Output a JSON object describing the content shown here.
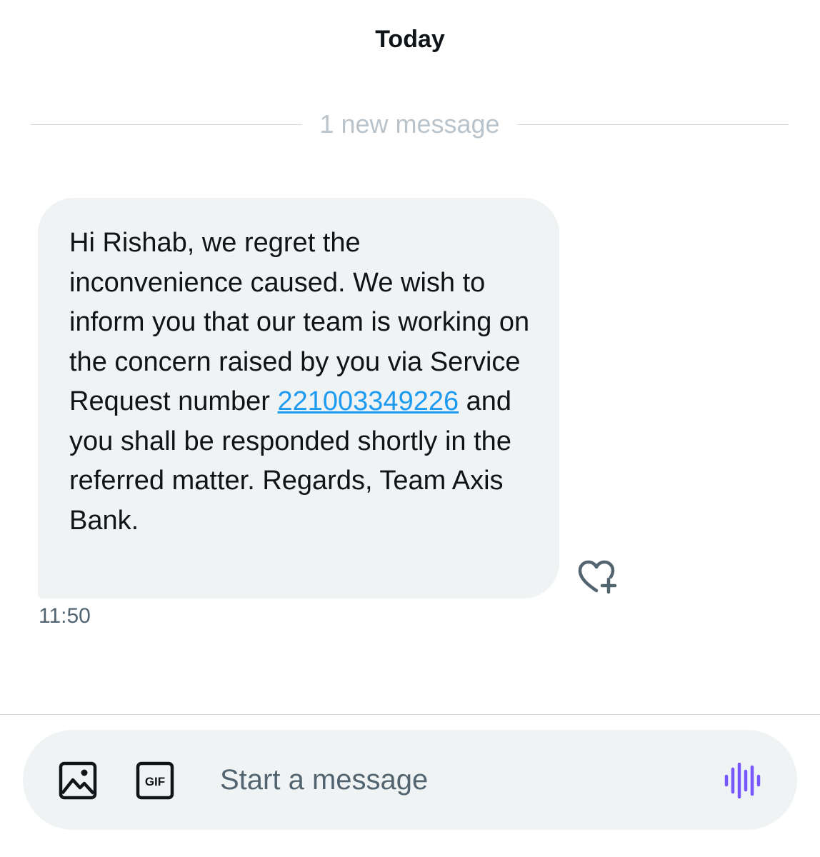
{
  "conversation": {
    "day_label": "Today",
    "new_messages_label": "1 new message"
  },
  "message": {
    "text_before_link": "Hi Rishab, we regret the inconvenience caused. We wish to inform you that our team is working on the concern raised by you via Service Request number ",
    "service_request_number": "221003349226",
    "text_after_link": " and you shall be responded shortly in the referred matter. Regards, Team Axis Bank.",
    "time": "11:50",
    "react_icon": "heart-plus-icon"
  },
  "composer": {
    "placeholder": "Start a message",
    "media_icon": "image-icon",
    "gif_icon": "gif-icon",
    "gif_text": "GIF",
    "voice_icon": "voice-wave-icon"
  },
  "colors": {
    "link": "#1d9bf0",
    "bubble_bg": "#eff3f4",
    "voice_accent": "#7856ff",
    "secondary_text": "#536471"
  }
}
